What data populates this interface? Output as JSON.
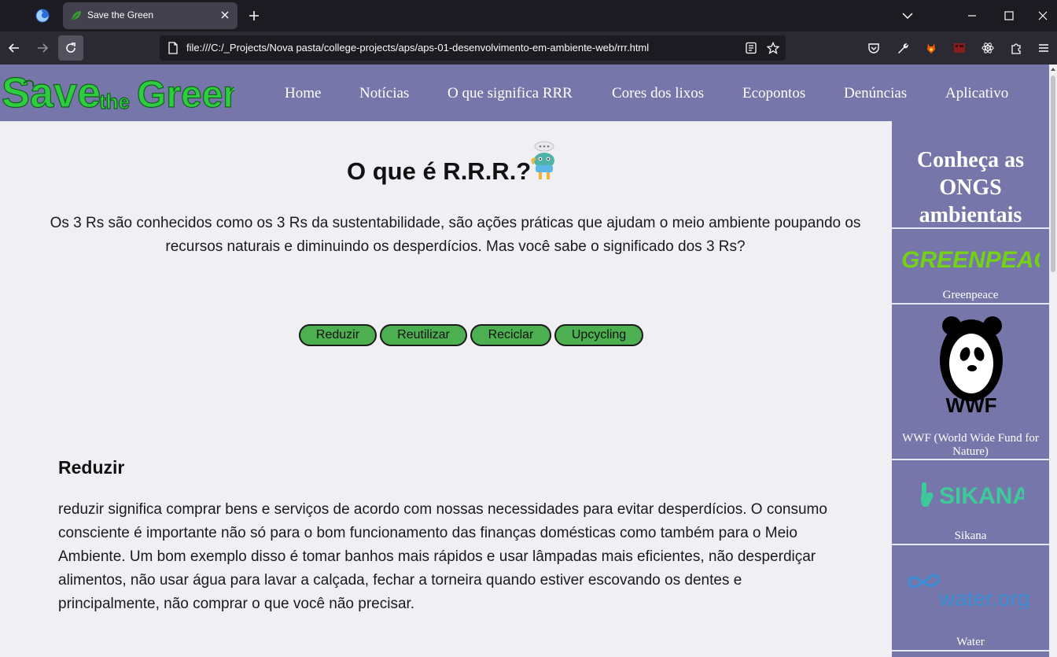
{
  "browser": {
    "tab_title": "Save the Green",
    "url": "file:///C:/_Projects/Nova pasta/college-projects/aps/aps-01-desenvolvimento-em-ambiente-web/rrr.html"
  },
  "site": {
    "logo_text": {
      "save": "Save",
      "the": "the",
      "green": "Green"
    },
    "menu": [
      "Home",
      "Notícias",
      "O que significa RRR",
      "Cores dos lixos",
      "Ecopontos",
      "Denúncias",
      "Aplicativo"
    ]
  },
  "main": {
    "title": "O que é R.R.R.?",
    "intro": "Os 3 Rs são conhecidos como os 3 Rs da sustentabilidade, são ações práticas que ajudam o meio ambiente poupando os recursos naturais e diminuindo os desperdícios. Mas você sabe o significado dos 3 Rs?",
    "buttons": [
      "Reduzir",
      "Reutilizar",
      "Reciclar",
      "Upcycling"
    ],
    "section_title": "Reduzir",
    "section_text": "reduzir significa comprar bens e serviços de acordo com nossas necessidades para evitar desperdícios. O consumo consciente é importante não só para o bom funcionamento das finanças domésticas como também para o Meio Ambiente. Um bom exemplo disso é tomar banhos mais rápidos e usar lâmpadas mais eficientes, não desperdiçar alimentos, não usar água para lavar a calçada, fechar a torneira quando estiver escovando os dentes e principalmente, não comprar o que você não precisar."
  },
  "sidebar": {
    "title": "Conheça as ONGS ambientais",
    "ongs": [
      {
        "name": "Greenpeace",
        "logo_text": "GREENPEACE"
      },
      {
        "name": "WWF (World Wide Fund for Nature)",
        "logo_text": "WWF"
      },
      {
        "name": "Sikana",
        "logo_text": "SIKANA"
      },
      {
        "name": "Water",
        "logo_text": "water.org"
      }
    ]
  },
  "colors": {
    "header_bg": "#7676aa",
    "logo_green": "#2ecc40",
    "button_green": "#4caf50",
    "page_bg": "#f0eff4"
  }
}
